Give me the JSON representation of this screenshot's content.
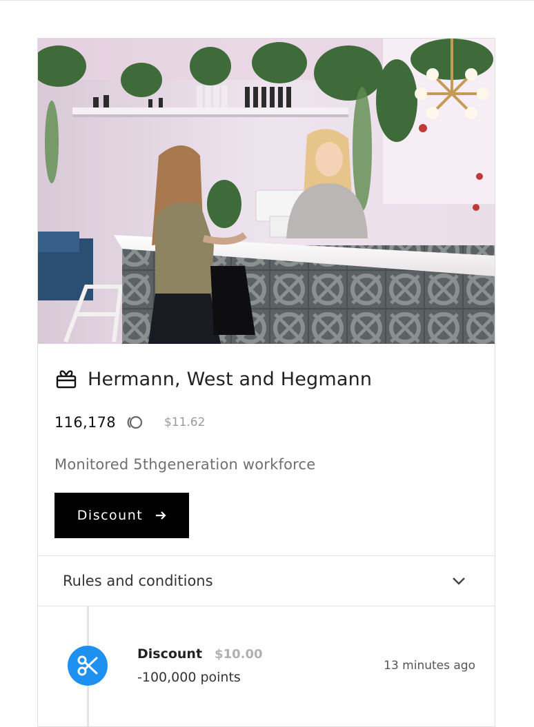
{
  "offer": {
    "title": "Hermann, West and Hegmann",
    "points": "116,178",
    "money": "$11.62",
    "description": "Monitored 5thgeneration workforce",
    "button_label": "Discount"
  },
  "rules": {
    "label": "Rules and conditions"
  },
  "history": [
    {
      "title": "Discount",
      "value": "$10.00",
      "points": "-100,000 points",
      "time": "13 minutes ago"
    }
  ],
  "icons": {
    "title": "gift-icon",
    "coin": "coin-icon",
    "button": "arrow-right-icon",
    "rules": "chevron-down-icon",
    "history": "scissors-icon"
  },
  "colors": {
    "button_bg": "#000000",
    "history_icon_bg": "#1e90f0"
  }
}
